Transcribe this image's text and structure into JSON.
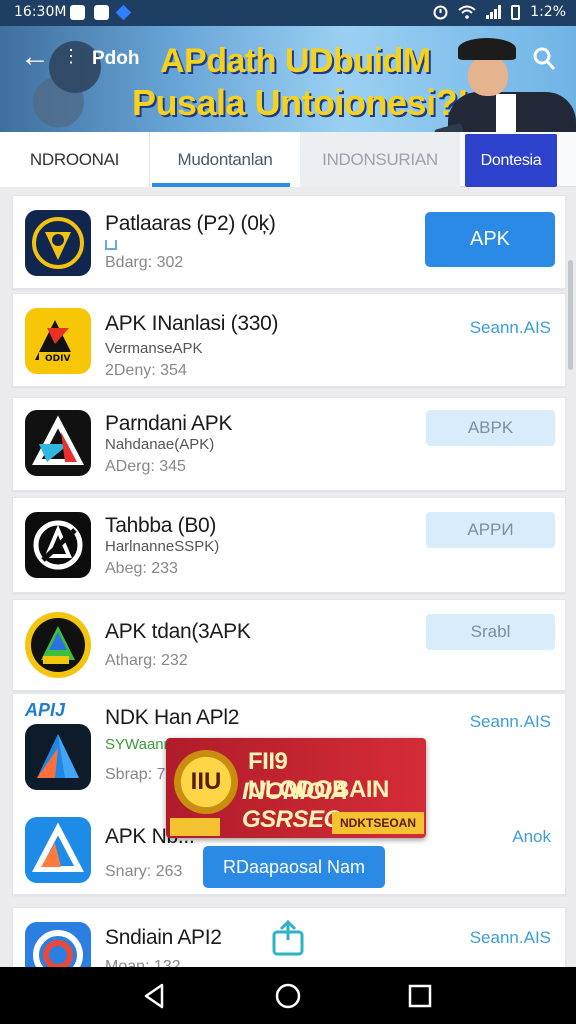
{
  "status_bar": {
    "time": "16:30M",
    "battery": "1:2%"
  },
  "banner": {
    "back_label": "Pdoh",
    "headline_line1": "APdath UDbuidM",
    "headline_line2": "Pusala Untoionesi?!"
  },
  "tabs": [
    {
      "label": "NDROONAI"
    },
    {
      "label": "Mudontanlan"
    },
    {
      "label": "INDONSURIAN"
    },
    {
      "label": "Dontesia"
    }
  ],
  "apps": [
    {
      "name": "Patlaaras (P2) (0ķ)",
      "subtitle": "",
      "meta": "Bdarg: 302",
      "action": "APK"
    },
    {
      "name": "APK INanlasi (330)",
      "subtitle": "VermanseAPK",
      "meta": "2Deny: 354",
      "action": "Seann.AIS"
    },
    {
      "name": "Parndani APK",
      "subtitle": "Nahdanae(APK)",
      "meta": "ADerg: 345",
      "action": "ABPK"
    },
    {
      "name": "Tahbba (B0)",
      "subtitle": "HarlnanneSSPK)",
      "meta": "Abeg: 233",
      "action": "APPИ"
    },
    {
      "name": "APK tdan(3APK",
      "subtitle": "",
      "meta": "Atharg: 232",
      "action": "Srabl"
    },
    {
      "name": "NDK Han APl2",
      "subtitle": "SYWaanna",
      "meta": "Sbrap: 7",
      "action": "Seann.AIS",
      "badge": "APIJ"
    },
    {
      "name": "APK Nb...",
      "subtitle": "",
      "meta": "Snary: 263",
      "action": "Anok"
    },
    {
      "name": "Sndiain API2",
      "subtitle": "",
      "meta": "Moan: 132",
      "action": "Seann.AIS"
    }
  ],
  "overlay_ad": {
    "coin_text": "IIU",
    "line1": "FII9 ULODOBAIN",
    "line2": "INONIOIA GSRSEO",
    "tag": "NDKTSEOAN",
    "button": "RDaapaosal Nam"
  },
  "colors": {
    "accent": "#2b8ae6",
    "status_bar": "#1f3e63",
    "tab_active": "#2c42cc",
    "link": "#3b9fd8"
  }
}
